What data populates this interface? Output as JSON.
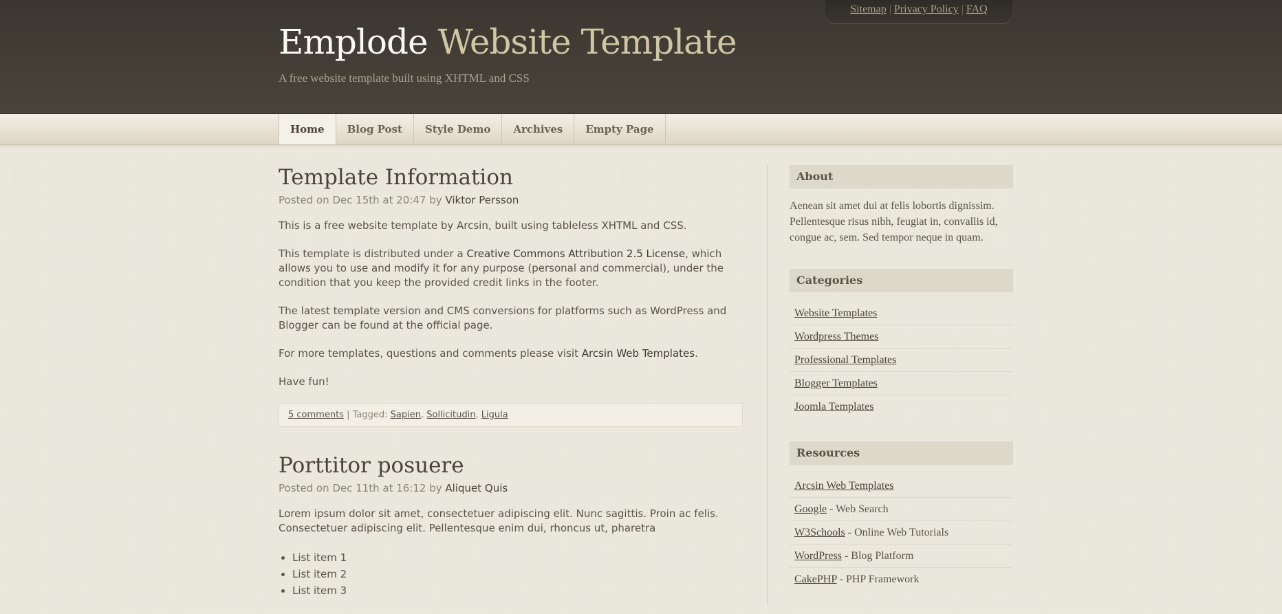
{
  "toplinks": {
    "sitemap": "Sitemap",
    "privacy": "Privacy Policy",
    "faq": "FAQ",
    "sep": "|"
  },
  "site": {
    "title_part1": "Emplode",
    "title_part2": "Website Template",
    "tagline": "A free website template built using XHTML and CSS"
  },
  "nav": {
    "items": [
      "Home",
      "Blog Post",
      "Style Demo",
      "Archives",
      "Empty Page"
    ],
    "active": "Home"
  },
  "posts": [
    {
      "title": "Template Information",
      "meta_prefix": "Posted on Dec 15th at 20:47 by",
      "author": "Viktor Persson",
      "p1": "This is a free website template by Arcsin, built using tableless XHTML and CSS.",
      "p2_a": "This template is distributed under a",
      "p2_link": "Creative Commons Attribution 2.5 License",
      "p2_b": ", which allows you to use and modify it for any purpose (personal and commercial), under the condition that you keep the provided credit links in the footer.",
      "p3": "The latest template version and CMS conversions for platforms such as WordPress and Blogger can be found at the official page.",
      "p4_a": "For more templates, questions and comments please visit",
      "p4_link": "Arcsin Web Templates",
      "p4_b": ".",
      "p5": "Have fun!",
      "comments": "5 comments",
      "tagged_label": "| Tagged:",
      "tags": [
        "Sapien",
        "Sollicitudin",
        "Ligula"
      ]
    },
    {
      "title": "Porttitor posuere",
      "meta_prefix": "Posted on Dec 11th at 16:12 by",
      "author": "Aliquet Quis",
      "p1": "Lorem ipsum dolor sit amet, consectetuer adipiscing elit. Nunc sagittis. Proin ac felis. Consectetuer adipiscing elit. Pellentesque enim dui, rhoncus ut, pharetra",
      "list": [
        "List item 1",
        "List item 2",
        "List item 3"
      ]
    }
  ],
  "sidebar": {
    "about": {
      "heading": "About",
      "text": "Aenean sit amet dui at felis lobortis dignissim. Pellentesque risus nibh, feugiat in, convallis id, congue ac, sem. Sed tempor neque in quam."
    },
    "categories": {
      "heading": "Categories",
      "items": [
        "Website Templates",
        "Wordpress Themes",
        "Professional Templates",
        "Blogger Templates",
        "Joomla Templates"
      ]
    },
    "resources": {
      "heading": "Resources",
      "items": [
        {
          "link": "Arcsin Web Templates",
          "desc": ""
        },
        {
          "link": "Google",
          "desc": " - Web Search"
        },
        {
          "link": "W3Schools",
          "desc": " - Online Web Tutorials"
        },
        {
          "link": "WordPress",
          "desc": " - Blog Platform"
        },
        {
          "link": "CakePHP",
          "desc": " - PHP Framework"
        }
      ]
    }
  }
}
